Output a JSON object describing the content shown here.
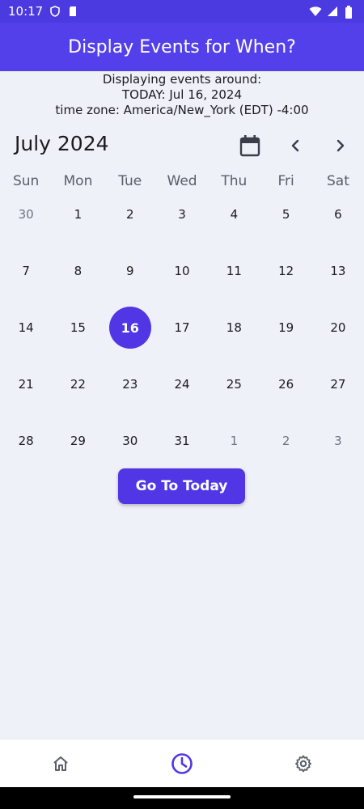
{
  "status_bar": {
    "time": "10:17",
    "left_icons": [
      "shield-icon",
      "sd-card-icon"
    ],
    "right_icons": [
      "wifi-icon",
      "signal-icon",
      "battery-icon"
    ]
  },
  "app_bar": {
    "title": "Display Events for When?"
  },
  "info": {
    "line1": "Displaying events around:",
    "line2": "TODAY: Jul 16, 2024",
    "line3": "time zone: America/New_York (EDT) -4:00"
  },
  "calendar": {
    "month_title": "July 2024",
    "icons": {
      "picker": "calendar-icon",
      "prev": "chevron-left-icon",
      "next": "chevron-right-icon"
    },
    "weekdays": [
      "Sun",
      "Mon",
      "Tue",
      "Wed",
      "Thu",
      "Fri",
      "Sat"
    ],
    "weeks": [
      [
        "30",
        "1",
        "2",
        "3",
        "4",
        "5",
        "6"
      ],
      [
        "7",
        "8",
        "9",
        "10",
        "11",
        "12",
        "13"
      ],
      [
        "14",
        "15",
        "16",
        "17",
        "18",
        "19",
        "20"
      ],
      [
        "21",
        "22",
        "23",
        "24",
        "25",
        "26",
        "27"
      ],
      [
        "28",
        "29",
        "30",
        "31",
        "1",
        "2",
        "3"
      ]
    ],
    "selected_day": "16",
    "accent_color": "#5136e6"
  },
  "actions": {
    "go_today_label": "Go To Today"
  },
  "bottom_nav": {
    "items": [
      "home-icon",
      "clock-icon",
      "settings-icon"
    ],
    "active_item": "clock-icon"
  }
}
